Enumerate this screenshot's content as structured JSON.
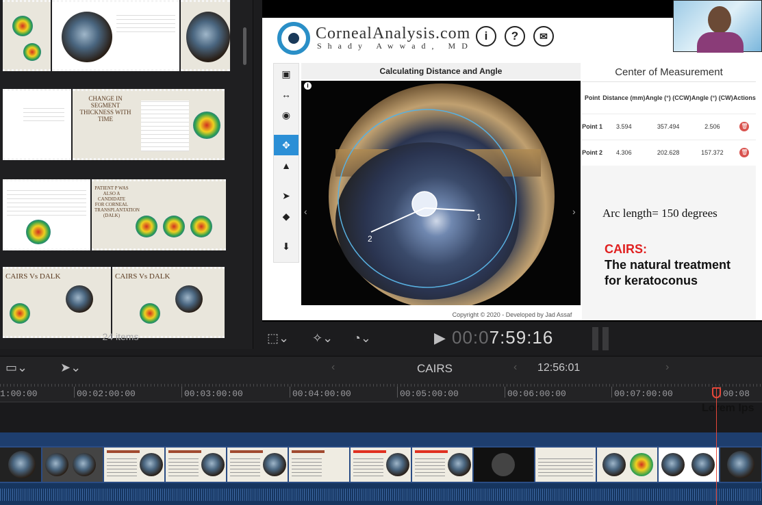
{
  "browser": {
    "item_count": "24 items",
    "thumbs": {
      "row2_title": "CHANGE IN SEGMENT THICKNESS WITH TIME",
      "row3_title": "PATIENT P WAS ALSO A CANDIDATE FOR CORNEAL TRANSPLANTATION (DALK)",
      "row4_left": "CAIRS Vs DALK",
      "row4_right": "CAIRS Vs DALK"
    }
  },
  "viewer": {
    "logo_text": "CornealAnalysis.com",
    "logo_sub": "Shady Awwad, MD",
    "header_icons": [
      "info-icon",
      "help-icon",
      "mail-icon"
    ],
    "canvas_title": "Calculating Distance and Angle",
    "point_labels": [
      "1",
      "2"
    ],
    "com": {
      "title": "Center of Measurement",
      "headers": [
        "Point",
        "Distance (mm)",
        "Angle (°) (CCW)",
        "Angle (°) (CW)",
        "Actions"
      ],
      "rows": [
        [
          "Point 1",
          "3.594",
          "357.494",
          "2.506"
        ],
        [
          "Point 2",
          "4.306",
          "202.628",
          "157.372"
        ]
      ]
    },
    "arc_text": "Arc length= 150 degrees",
    "cairs_label": "CAIRS:",
    "cairs_body": "The natural treatment for keratoconus",
    "copyright": "Copyright © 2020 - Developed by Jad Assaf"
  },
  "controls": {
    "timecode_dim": "00:0",
    "timecode_bright": "7:59:16"
  },
  "timeline": {
    "project_title": "CAIRS",
    "duration": "12:56:01",
    "ruler": [
      "1:00:00",
      "00:02:00:00",
      "00:03:00:00",
      "00:04:00:00",
      "00:05:00:00",
      "00:06:00:00",
      "00:07:00:00",
      "00:08"
    ],
    "marker_title": "Lorem Ips"
  },
  "colors": {
    "accent_blue": "#2b8fd6",
    "cairs_red": "#e02020",
    "playhead": "#e8483a",
    "clip_track": "#2a4c84"
  }
}
